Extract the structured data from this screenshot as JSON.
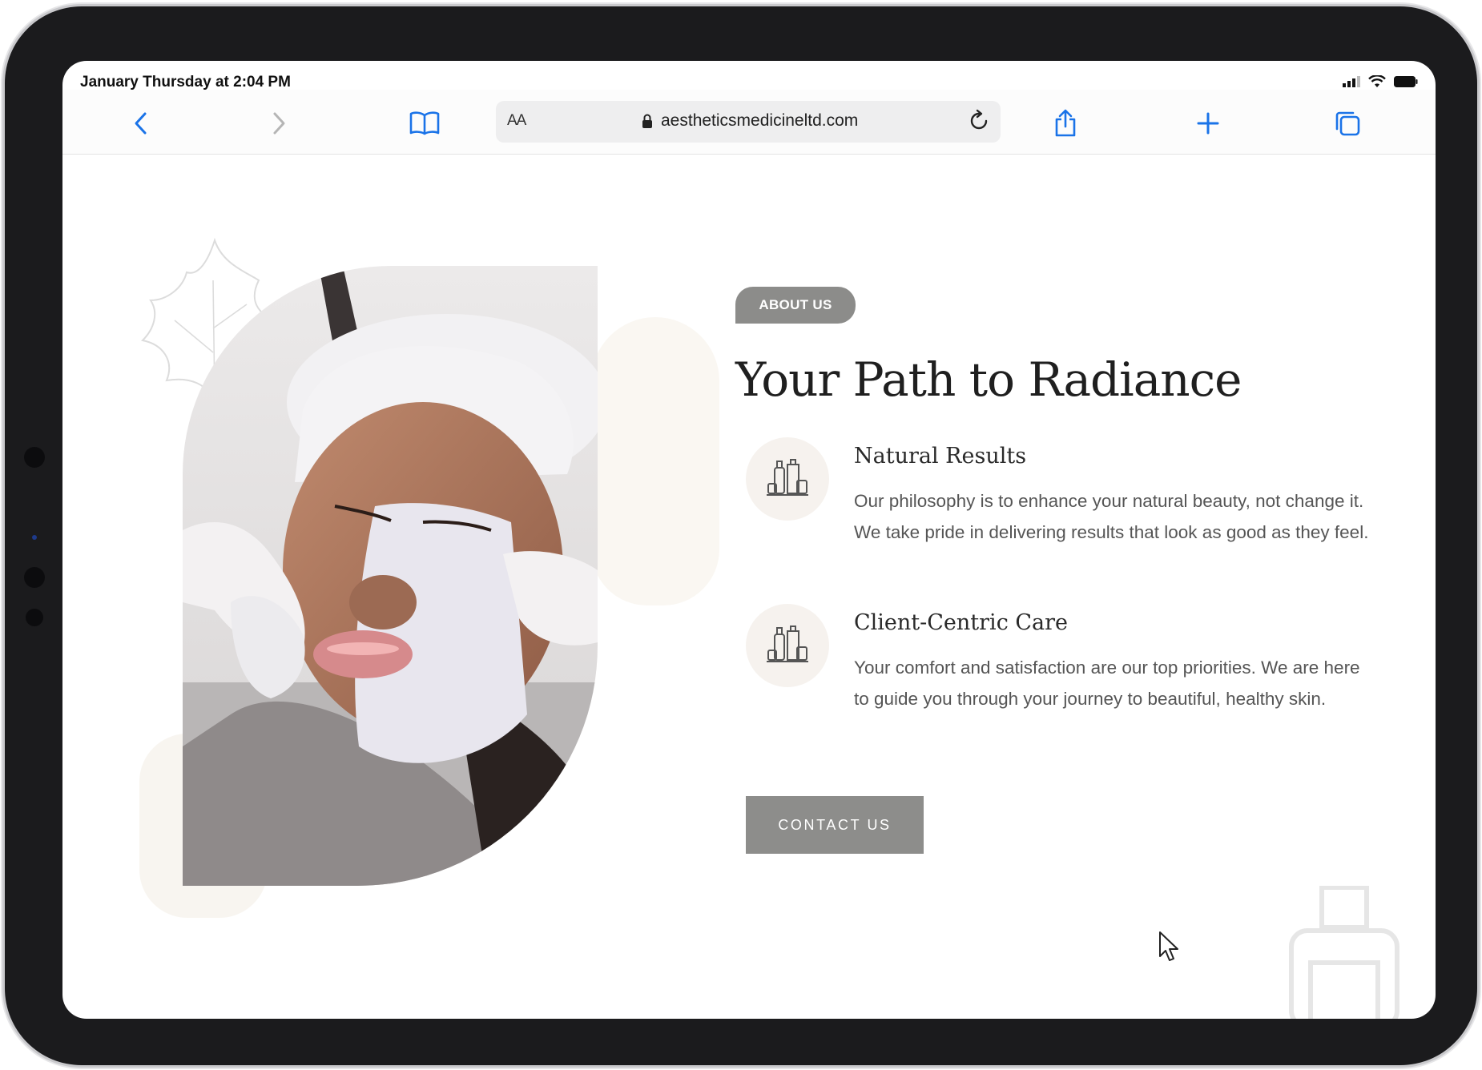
{
  "status_bar": {
    "time": "January Thursday at 2:04 PM"
  },
  "browser": {
    "text_size_label": "AA",
    "url": "aestheticsmedicineltd.com"
  },
  "icons": {
    "back": "chevron-left-icon",
    "forward": "chevron-right-icon",
    "bookmarks": "book-icon",
    "lock": "lock-icon",
    "reload": "reload-icon",
    "share": "share-icon",
    "new_tab": "plus-icon",
    "tabs": "tabs-icon",
    "feature": "bottles-icon"
  },
  "colors": {
    "accent_blue": "#1a73e8",
    "badge_gray": "#8c8c8a",
    "button_gray": "#8d8d8b",
    "icon_circle_bg": "#f6f2ee"
  },
  "about": {
    "badge": "ABOUT US",
    "title": "Your Path to Radiance",
    "features": [
      {
        "title": "Natural Results",
        "text": "Our philosophy is to enhance your natural beauty, not change it. We take pride in delivering results that look as good as they feel."
      },
      {
        "title": "Client-Centric Care",
        "text": "Your comfort and satisfaction are our top priorities. We are here to guide you through your journey to beautiful, healthy skin."
      }
    ],
    "cta_label": "CONTACT US"
  }
}
